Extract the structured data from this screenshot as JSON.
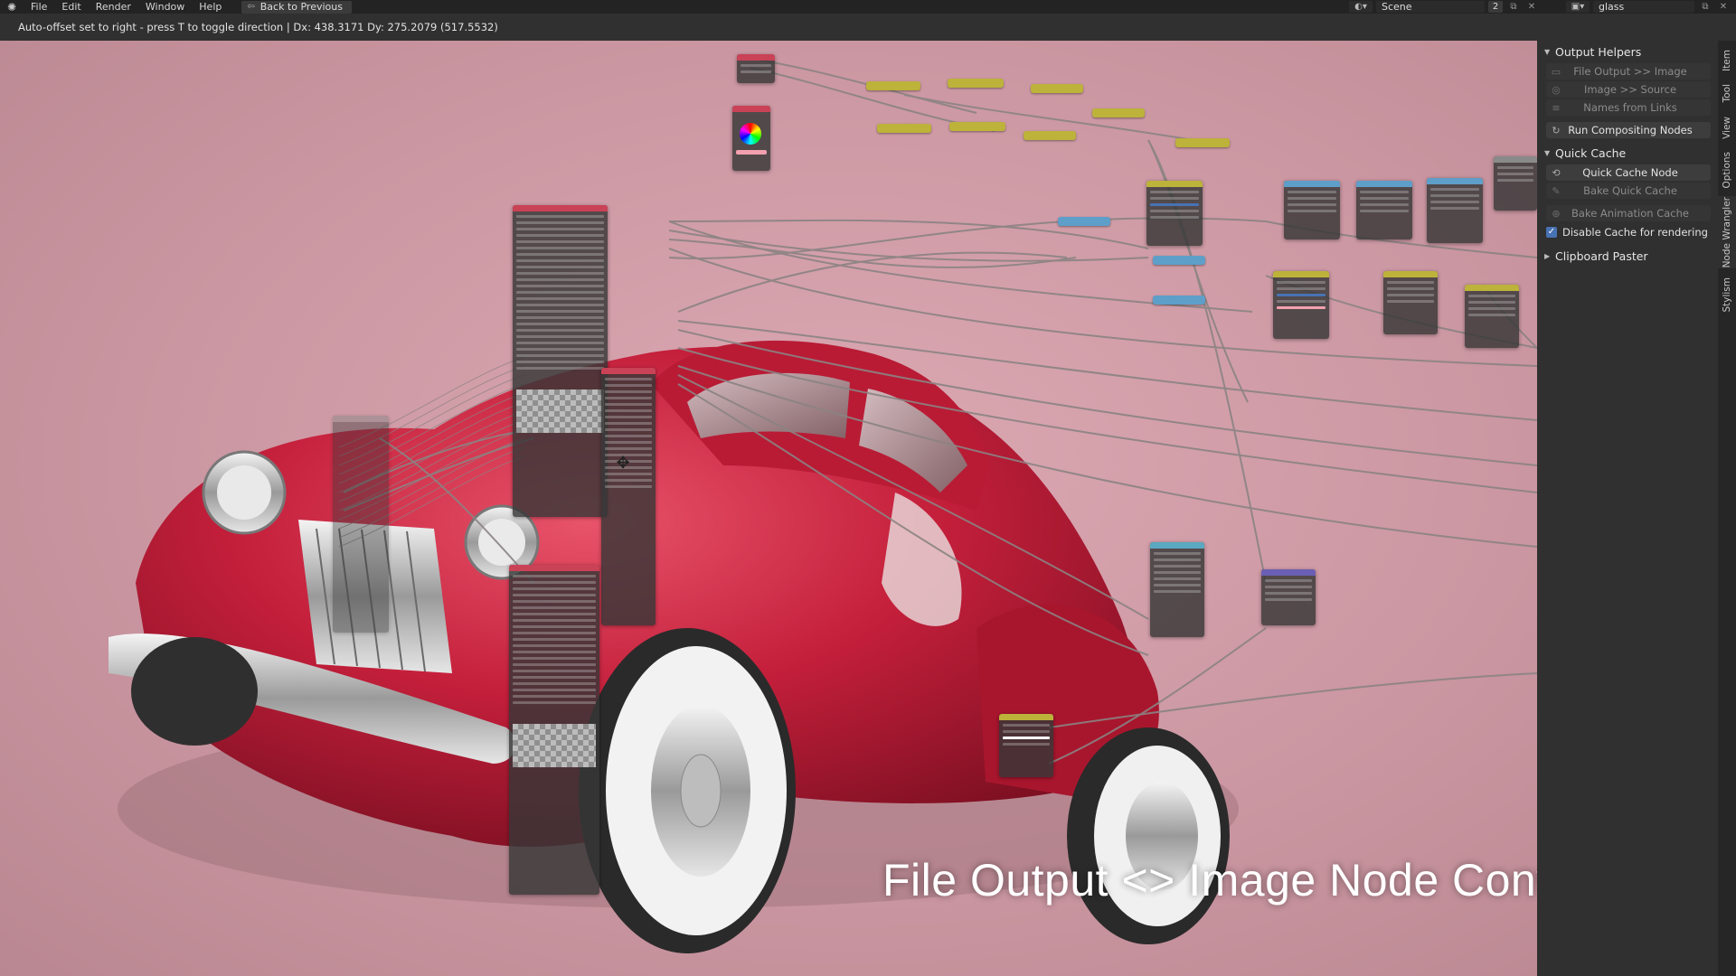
{
  "menu": {
    "items": [
      "File",
      "Edit",
      "Render",
      "Window",
      "Help"
    ],
    "back_label": "Back to Previous"
  },
  "scene": {
    "name": "Scene",
    "count": "2"
  },
  "view_layer": {
    "name": "glass"
  },
  "status": {
    "message": "Auto-offset set to right - press T to toggle direction  |  Dx: 438.3171   Dy: 275.2079 (517.5532)"
  },
  "caption": "File Output <> Image Node Conversion",
  "sidebar": {
    "output_helpers": {
      "title": "Output Helpers",
      "buttons": [
        "File Output >> Image",
        "Image >> Source",
        "Names from Links",
        "Run Compositing Nodes"
      ]
    },
    "quick_cache": {
      "title": "Quick Cache",
      "buttons": [
        "Quick Cache Node",
        "Bake Quick Cache",
        "Bake Animation Cache"
      ],
      "checkbox_label": "Disable Cache for rendering",
      "checkbox_checked": true
    },
    "clipboard": {
      "title": "Clipboard Paster"
    }
  },
  "tabs": [
    "Item",
    "Tool",
    "View",
    "Options",
    "Node Wrangler",
    "Stylism"
  ],
  "colors": {
    "accent": "#4772b3",
    "node_yellow": "#bdb23a",
    "node_blue": "#5e9fc9",
    "node_red": "#c94256",
    "node_teal": "#5aa9c0",
    "car_red": "#c01f3a"
  }
}
